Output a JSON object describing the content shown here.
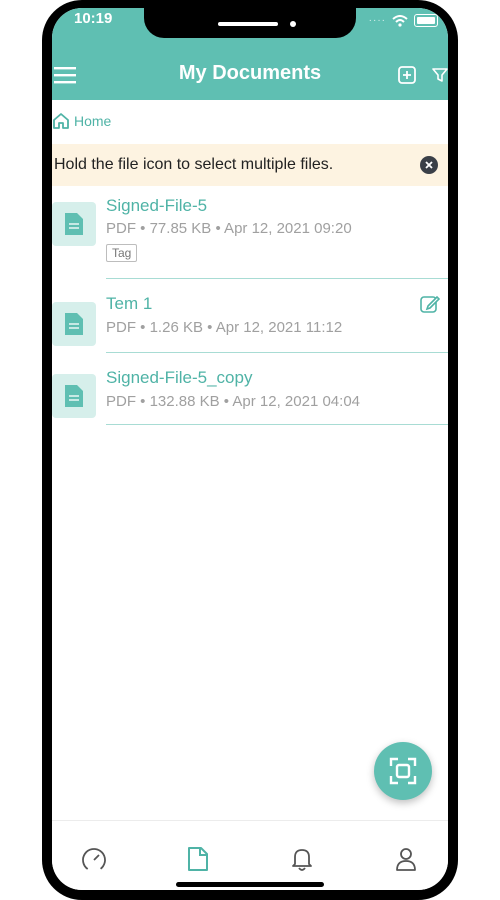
{
  "status_bar": {
    "time": "10:19"
  },
  "header": {
    "title": "My Documents"
  },
  "breadcrumb": {
    "home_label": "Home"
  },
  "hint": {
    "text": "Hold the file icon to select multiple files."
  },
  "files": [
    {
      "name": "Signed-File-5",
      "meta": "PDF • 77.85 KB • Apr 12, 2021 09:20",
      "tag": "Tag"
    },
    {
      "name": "Tem 1",
      "meta": "PDF • 1.26 KB • Apr 12, 2021 11:12"
    },
    {
      "name": "Signed-File-5_copy",
      "meta": "PDF • 132.88 KB • Apr 12, 2021 04:04"
    }
  ],
  "colors": {
    "accent": "#5fbfb2",
    "accent_text": "#4fb3a6",
    "hint_bg": "#fdf3e1"
  },
  "icons": {
    "menu": "menu-icon",
    "add": "add-icon",
    "filter": "filter-icon",
    "home": "home-icon",
    "close": "close-icon",
    "file": "file-icon",
    "edit": "edit-icon",
    "scan": "scan-icon",
    "nav": [
      "dashboard-icon",
      "documents-icon",
      "bell-icon",
      "user-icon"
    ]
  }
}
